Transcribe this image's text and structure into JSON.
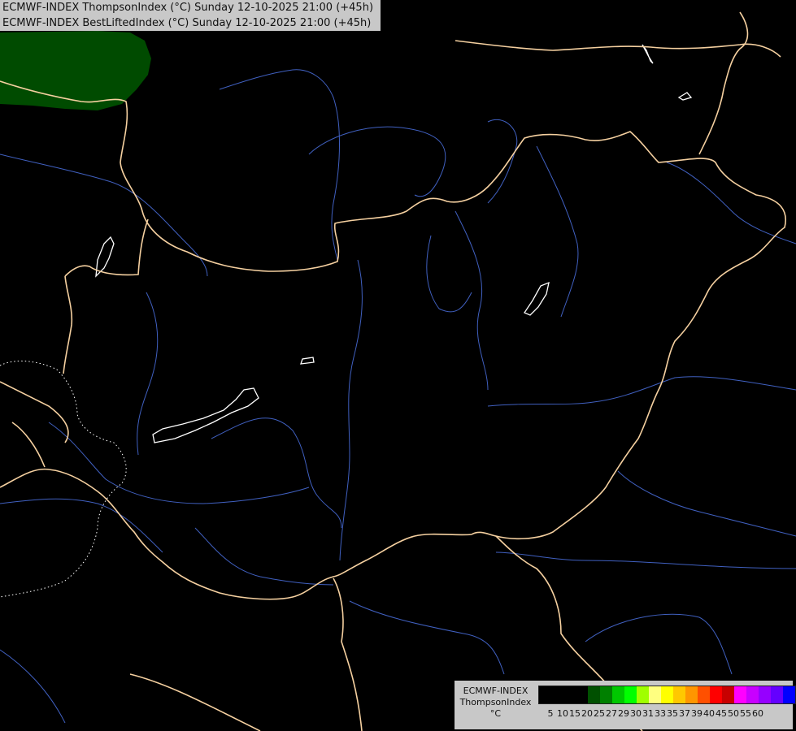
{
  "header": {
    "line1": "ECMWF-INDEX ThompsonIndex (°C) Sunday 12-10-2025 21:00 (+45h)",
    "line2": "ECMWF-INDEX BestLiftedIndex (°C) Sunday 12-10-2025 21:00 (+45h)"
  },
  "legend": {
    "line1": "ECMWF-INDEX",
    "line2": "ThompsonIndex",
    "line3": "°C",
    "colors": [
      "#000000",
      "#000000",
      "#000000",
      "#000000",
      "#005000",
      "#008000",
      "#00c800",
      "#00ff00",
      "#a0ff00",
      "#ffff80",
      "#ffff00",
      "#ffc800",
      "#ff9600",
      "#ff5000",
      "#ff0000",
      "#c80000",
      "#ff00ff",
      "#c800ff",
      "#9600ff",
      "#6400ff",
      "#0000ff"
    ],
    "ticks": [
      "5",
      "10",
      "15",
      "20",
      "25",
      "27",
      "29",
      "30",
      "31",
      "33",
      "35",
      "37",
      "39",
      "40",
      "45",
      "50",
      "55",
      "60"
    ]
  },
  "map": {
    "background": "#000000",
    "borders_color": "#f5d0a0",
    "rivers_color": "#4060c0",
    "lakes_color": "#ffffff",
    "warm_region_color": "#004b00"
  }
}
